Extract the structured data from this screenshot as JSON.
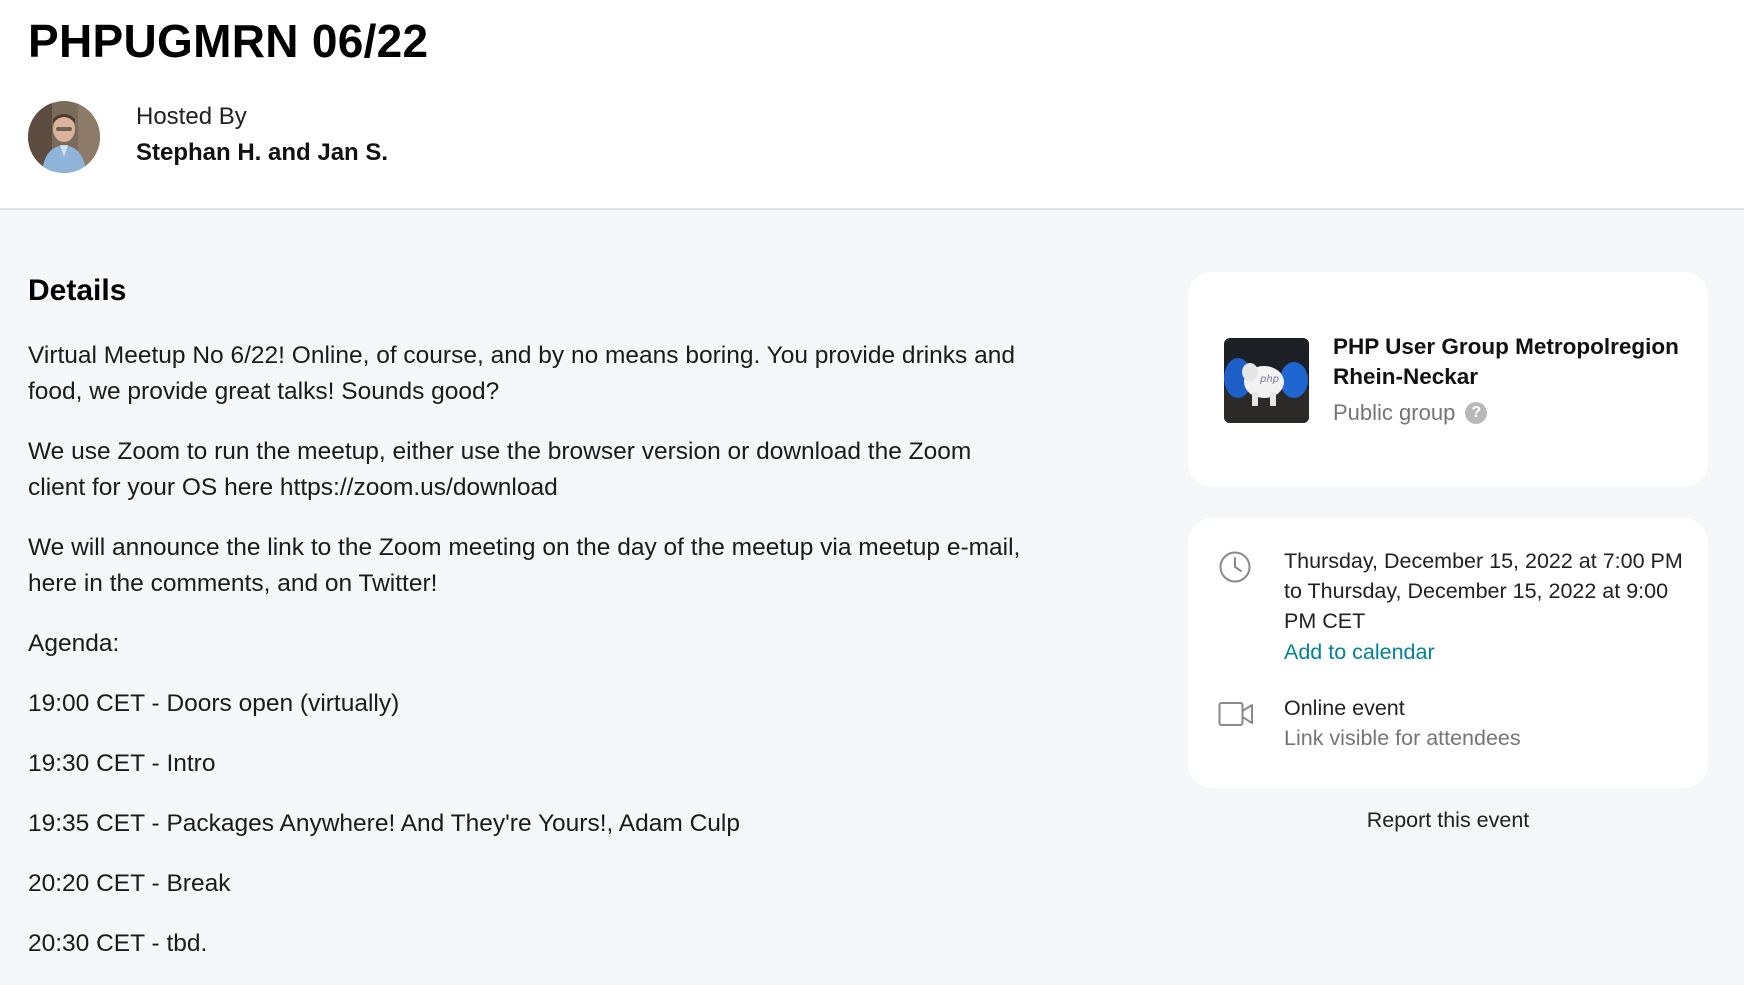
{
  "event": {
    "title": "PHPUGMRN 06/22",
    "hosted_by_label": "Hosted By",
    "hosts": "Stephan H. and Jan S."
  },
  "details": {
    "heading": "Details",
    "paragraphs": [
      "Virtual Meetup No 6/22! Online, of course, and by no means boring. You provide drinks and food, we provide great talks! Sounds good?",
      "We use Zoom to run the meetup, either use the browser version or download the Zoom client for your OS here https://zoom.us/download",
      "We will announce the link to the Zoom meeting on the day of the meetup via meetup e-mail, here in the comments, and on Twitter!",
      "Agenda:",
      "19:00 CET - Doors open (virtually)",
      "19:30 CET - Intro",
      "19:35 CET - Packages Anywhere! And They're Yours!, Adam Culp",
      "20:20 CET - Break",
      "20:30 CET - tbd."
    ]
  },
  "group": {
    "name": "PHP User Group Metropolregion Rhein-Neckar",
    "type": "Public group",
    "help_icon": "?"
  },
  "when": {
    "datetime": "Thursday, December 15, 2022 at 7:00 PM to Thursday, December 15, 2022 at 9:00 PM CET",
    "add_to_calendar": "Add to calendar",
    "location_type": "Online event",
    "location_note": "Link visible for attendees"
  },
  "report": "Report this event",
  "icons": {
    "clock": "clock-icon",
    "video": "video-camera-icon",
    "help": "question-circle-icon"
  },
  "colors": {
    "link": "#00829b",
    "muted": "#757575",
    "background": "#f6f7f8"
  }
}
